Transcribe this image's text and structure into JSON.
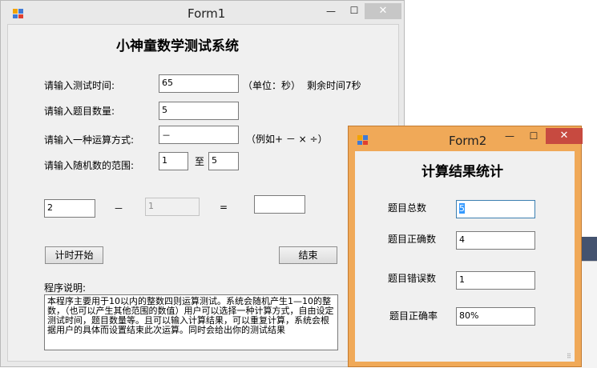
{
  "form1": {
    "title": "Form1",
    "minimize": "—",
    "maximize": "☐",
    "close": "✕",
    "heading": "小神童数学测试系统",
    "labels": {
      "test_time": "请输入测试时间:",
      "question_count": "请输入题目数量:",
      "operator": "请输入一种运算方式:",
      "range": "请输入随机数的范围:",
      "unit": "（单位：秒）",
      "remaining": "剩余时间7秒",
      "example": "（例如+ － × ÷）",
      "to": "至",
      "equals": "=",
      "operator_display": "－",
      "notes_title": "程序说明:"
    },
    "inputs": {
      "test_time": "65",
      "question_count": "5",
      "operator": "－",
      "range_from": "1",
      "range_to": "5",
      "operand1": "2",
      "operand2": "1",
      "answer": ""
    },
    "buttons": {
      "start": "计时开始",
      "end": "结束"
    },
    "description": "本程序主要用于10以内的整数四则运算测试。系统会随机产生1—10的整数，（也可以产生其他范围的数值）用户可以选择一种计算方式，自由设定测试时间，题目数量等。且可以输入计算结果，可以重复计算，系统会根据用户的具体而设置结束此次运算。同时会给出你的测试结果"
  },
  "form2": {
    "title": "Form2",
    "minimize": "—",
    "maximize": "☐",
    "close": "✕",
    "heading": "计算结果统计",
    "labels": {
      "total": "题目总数",
      "correct": "题目正确数",
      "wrong": "题目错误数",
      "rate": "题目正确率"
    },
    "values": {
      "total": "5",
      "correct": "4",
      "wrong": "1",
      "rate": "80%"
    }
  }
}
